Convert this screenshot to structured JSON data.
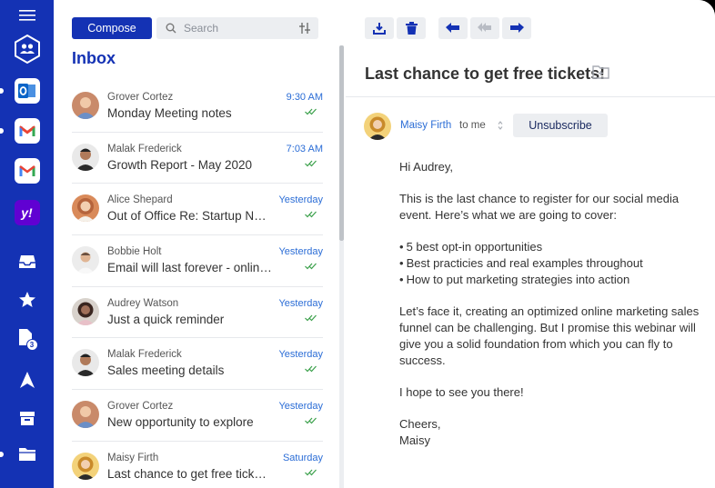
{
  "accounts": [
    {
      "name": "outlook-icon"
    },
    {
      "name": "gmail-icon"
    },
    {
      "name": "gmail-icon"
    },
    {
      "name": "yahoo-icon",
      "label": "y!"
    }
  ],
  "rail": {
    "drafts_badge": "3"
  },
  "toolbar": {
    "compose_label": "Compose",
    "search_placeholder": "Search"
  },
  "inbox": {
    "title": "Inbox",
    "messages": [
      {
        "sender": "Grover Cortez",
        "subject": "Monday Meeting notes",
        "time": "9:30 AM",
        "avatar_color": "#c98a6a"
      },
      {
        "sender": "Malak Frederick",
        "subject": "Growth Report - May 2020",
        "time": "7:03 AM",
        "avatar_color": "#4a4a4a"
      },
      {
        "sender": "Alice Shepard",
        "subject": "Out of Office Re: Startup New...",
        "time": "Yesterday",
        "avatar_color": "#b5643c"
      },
      {
        "sender": "Bobbie Holt",
        "subject": "Email will last forever - online...",
        "time": "Yesterday",
        "avatar_color": "#8a7a70"
      },
      {
        "sender": "Audrey Watson",
        "subject": "Just a quick reminder",
        "time": "Yesterday",
        "avatar_color": "#5a3a30"
      },
      {
        "sender": "Malak Frederick",
        "subject": "Sales meeting details",
        "time": "Yesterday",
        "avatar_color": "#4a4a4a"
      },
      {
        "sender": "Grover Cortez",
        "subject": "New opportunity to explore",
        "time": "Yesterday",
        "avatar_color": "#c98a6a"
      },
      {
        "sender": "Maisy Firth",
        "subject": "Last chance to get free tickets!",
        "time": "Saturday",
        "avatar_color": "#d9a040"
      }
    ]
  },
  "mail": {
    "title": "Last chance to get free tickets!",
    "from": "Maisy Firth",
    "to": "to me",
    "unsubscribe_label": "Unsubscribe",
    "greeting": "Hi Audrey,",
    "intro": "This is the last chance to register for our social media event. Here’s what we are going to cover:",
    "bullets": [
      "5 best opt-in opportunities",
      "Best practicies and real examples throughout",
      "How to put marketing strategies into action"
    ],
    "para2": "Let’s face it, creating an optimized online marketing sales funnel can be challenging. But I promise this webinar will give you a solid foundation from which you can fly to success.",
    "para3": "I hope to see you there!",
    "signoff": "Cheers,",
    "signature": "Maisy"
  },
  "colors": {
    "brand": "#1432b4",
    "link": "#2b6dd6",
    "read_check": "#3aa04a"
  }
}
